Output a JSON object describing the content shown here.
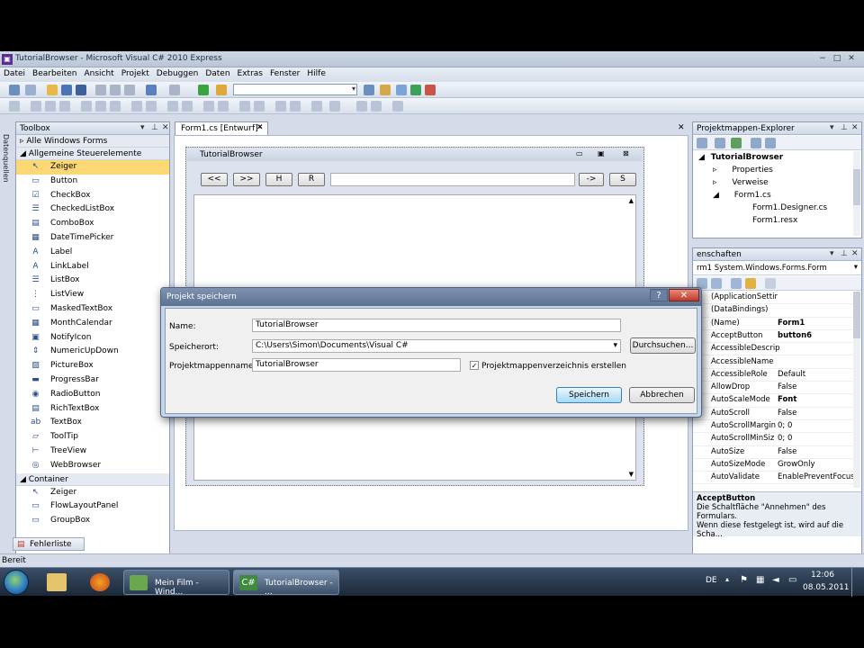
{
  "window": {
    "title": "TutorialBrowser - Microsoft Visual C# 2010 Express",
    "min": "−",
    "max": "□",
    "close": "✕"
  },
  "menu": [
    "Datei",
    "Bearbeiten",
    "Ansicht",
    "Projekt",
    "Debuggen",
    "Daten",
    "Extras",
    "Fenster",
    "Hilfe"
  ],
  "side_strip_label": "Datenquellen",
  "toolbox": {
    "title": "Toolbox",
    "cat_all": "Alle Windows Forms",
    "cat_common": "Allgemeine Steuerelemente",
    "items": [
      {
        "label": "Zeiger",
        "icon": "pointer-icon",
        "glyph": "↖"
      },
      {
        "label": "Button",
        "icon": "button-icon",
        "glyph": "▭"
      },
      {
        "label": "CheckBox",
        "icon": "checkbox-icon",
        "glyph": "☑"
      },
      {
        "label": "CheckedListBox",
        "icon": "checkedlistbox-icon",
        "glyph": "☰"
      },
      {
        "label": "ComboBox",
        "icon": "combobox-icon",
        "glyph": "▤"
      },
      {
        "label": "DateTimePicker",
        "icon": "datetimepicker-icon",
        "glyph": "▦"
      },
      {
        "label": "Label",
        "icon": "label-icon",
        "glyph": "A"
      },
      {
        "label": "LinkLabel",
        "icon": "linklabel-icon",
        "glyph": "A"
      },
      {
        "label": "ListBox",
        "icon": "listbox-icon",
        "glyph": "☰"
      },
      {
        "label": "ListView",
        "icon": "listview-icon",
        "glyph": "⋮"
      },
      {
        "label": "MaskedTextBox",
        "icon": "maskedtextbox-icon",
        "glyph": "▭"
      },
      {
        "label": "MonthCalendar",
        "icon": "monthcalendar-icon",
        "glyph": "▦"
      },
      {
        "label": "NotifyIcon",
        "icon": "notifyicon-icon",
        "glyph": "▣"
      },
      {
        "label": "NumericUpDown",
        "icon": "numericupdown-icon",
        "glyph": "⇕"
      },
      {
        "label": "PictureBox",
        "icon": "picturebox-icon",
        "glyph": "▨"
      },
      {
        "label": "ProgressBar",
        "icon": "progressbar-icon",
        "glyph": "▬"
      },
      {
        "label": "RadioButton",
        "icon": "radiobutton-icon",
        "glyph": "◉"
      },
      {
        "label": "RichTextBox",
        "icon": "richtextbox-icon",
        "glyph": "▤"
      },
      {
        "label": "TextBox",
        "icon": "textbox-icon",
        "glyph": "ab"
      },
      {
        "label": "ToolTip",
        "icon": "tooltip-icon",
        "glyph": "▱"
      },
      {
        "label": "TreeView",
        "icon": "treeview-icon",
        "glyph": "⊢"
      },
      {
        "label": "WebBrowser",
        "icon": "webbrowser-icon",
        "glyph": "◎"
      }
    ],
    "cat_container": "Container",
    "container_items": [
      {
        "label": "Zeiger",
        "icon": "pointer-icon",
        "glyph": "↖"
      },
      {
        "label": "FlowLayoutPanel",
        "icon": "flowlayoutpanel-icon",
        "glyph": "▭"
      },
      {
        "label": "GroupBox",
        "icon": "groupbox-icon",
        "glyph": "▭"
      }
    ]
  },
  "designer": {
    "tab": "Form1.cs [Entwurf]*",
    "form_title": "TutorialBrowser",
    "btn_back": "<<",
    "btn_forward": ">>",
    "btn_home": "H",
    "btn_refresh": "R",
    "btn_go": "->",
    "btn_search": "S"
  },
  "solution_explorer": {
    "title": "Projektmappen-Explorer",
    "tree": [
      "TutorialBrowser",
      "Properties",
      "Verweise",
      "Form1.cs",
      "Form1.Designer.cs",
      "Form1.resx"
    ]
  },
  "properties": {
    "title": "enschaften",
    "object": "rm1  System.Windows.Forms.Form",
    "rows": [
      {
        "name": "(ApplicationSettir",
        "value": ""
      },
      {
        "name": "(DataBindings)",
        "value": ""
      },
      {
        "name": "(Name)",
        "value": "Form1"
      },
      {
        "name": "AcceptButton",
        "value": "button6"
      },
      {
        "name": "AccessibleDescrip",
        "value": ""
      },
      {
        "name": "AccessibleName",
        "value": ""
      },
      {
        "name": "AccessibleRole",
        "value": "Default"
      },
      {
        "name": "AllowDrop",
        "value": "False"
      },
      {
        "name": "AutoScaleMode",
        "value": "Font"
      },
      {
        "name": "AutoScroll",
        "value": "False"
      },
      {
        "name": "AutoScrollMargin",
        "value": "0; 0"
      },
      {
        "name": "AutoScrollMinSiz",
        "value": "0; 0"
      },
      {
        "name": "AutoSize",
        "value": "False"
      },
      {
        "name": "AutoSizeMode",
        "value": "GrowOnly"
      },
      {
        "name": "AutoValidate",
        "value": "EnablePreventFocus"
      }
    ],
    "desc_title": "AcceptButton",
    "desc_text_1": "Die Schaltfläche \"Annehmen\" des Formulars.",
    "desc_text_2": "Wenn diese festgelegt ist, wird auf die Scha..."
  },
  "error_list": "Fehlerliste",
  "status": "Bereit",
  "dialog": {
    "title": "Projekt speichern",
    "help": "?",
    "close": "✕",
    "name_label": "Name:",
    "name_value": "TutorialBrowser",
    "location_label": "Speicherort:",
    "location_value": "C:\\Users\\Simon\\Documents\\Visual C#",
    "browse": "Durchsuchen...",
    "solution_label": "Projektmappenname:",
    "solution_value": "TutorialBrowser",
    "create_dir_label": "Projektmappenverzeichnis erstellen",
    "save": "Speichern",
    "cancel": "Abbrechen"
  },
  "taskbar": {
    "win1": "Mein Film - Wind...",
    "win2": "TutorialBrowser - ...",
    "lang": "DE",
    "time": "12:06",
    "date": "08.05.2011"
  }
}
